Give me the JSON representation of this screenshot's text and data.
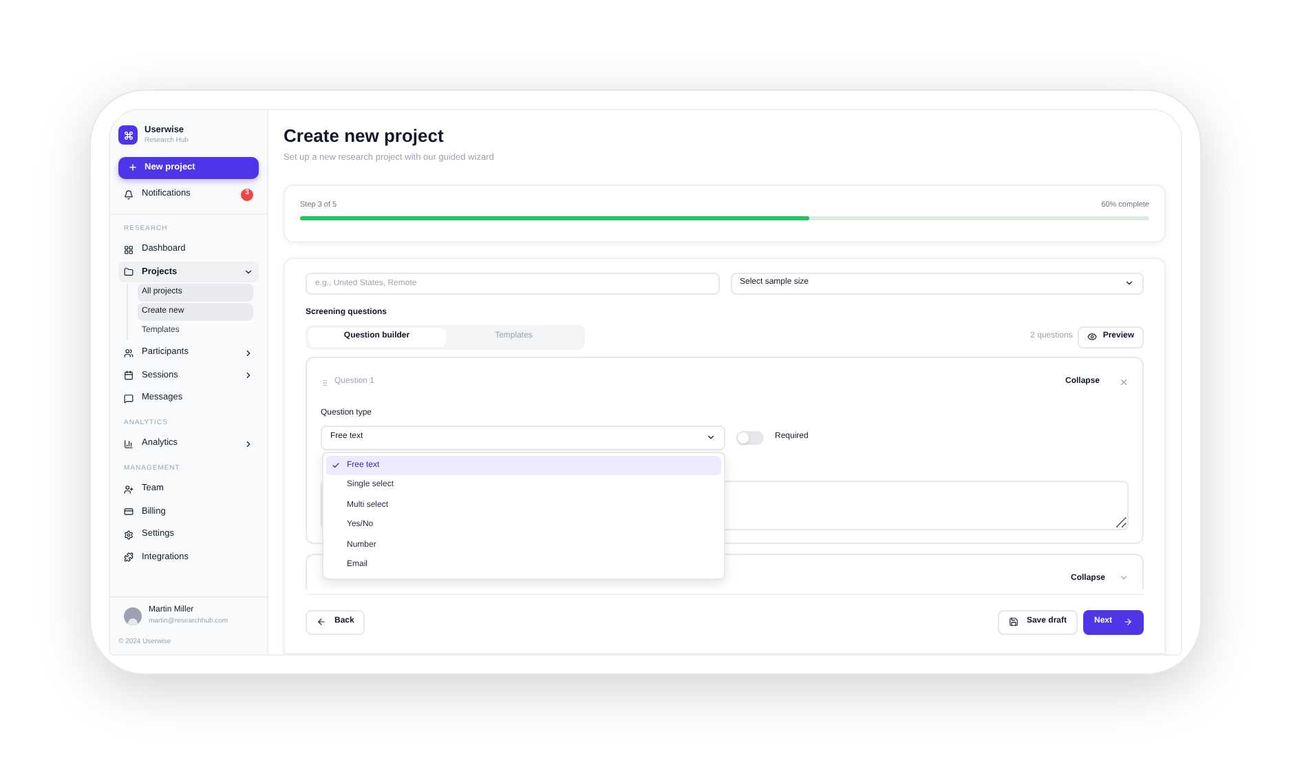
{
  "brand": {
    "name": "Userwise",
    "subtitle": "Research Hub"
  },
  "new_project_button": "New project",
  "notifications": {
    "label": "Notifications",
    "count": "3"
  },
  "sidebar_sections": [
    {
      "title": "RESEARCH",
      "items": [
        {
          "label": "Dashboard",
          "selected": false
        },
        {
          "label": "Projects",
          "selected": true,
          "expanded": true,
          "children": [
            {
              "label": "All projects",
              "selected": true
            },
            {
              "label": "Create new",
              "selected": true
            },
            {
              "label": "Templates",
              "selected": false
            }
          ]
        },
        {
          "label": "Participants",
          "selected": false,
          "expanded": false
        },
        {
          "label": "Sessions",
          "selected": false,
          "expanded": false
        },
        {
          "label": "Messages",
          "selected": false
        }
      ]
    },
    {
      "title": "ANALYTICS",
      "items": [
        {
          "label": "Analytics",
          "selected": false,
          "expanded": false
        }
      ]
    },
    {
      "title": "MANAGEMENT",
      "items": [
        {
          "label": "Team",
          "selected": false
        },
        {
          "label": "Billing",
          "selected": false
        },
        {
          "label": "Settings",
          "selected": false
        },
        {
          "label": "Integrations",
          "selected": false
        }
      ]
    }
  ],
  "user": {
    "name": "Martin Miller",
    "email": "martin@researchhub.com"
  },
  "footer": "© 2024 Userwise",
  "page": {
    "title": "Create new project",
    "subtitle": "Set up a new research project with our guided wizard"
  },
  "progress": {
    "step": "Step 3 of 5",
    "percent": "60% complete",
    "level": 0.6
  },
  "form": {
    "location_field": {
      "placeholder": "e.g., United States, Remote"
    },
    "sample_size": {
      "value": "Select sample size"
    },
    "section_label": "Screening questions",
    "tabs": [
      {
        "label": "Question builder",
        "selected": true
      },
      {
        "label": "Templates",
        "selected": false
      }
    ],
    "question_count": "2 questions",
    "preview_button": "Preview",
    "questions": [
      {
        "title": "Question 1",
        "collapse": "Collapse",
        "type_label": "Question type",
        "type_value": "Free text",
        "required": {
          "label": "Required",
          "on": false
        }
      },
      {
        "collapse": "Collapse"
      }
    ],
    "type_options": [
      {
        "label": "Free text",
        "selected": true
      },
      {
        "label": "Single select",
        "selected": false
      },
      {
        "label": "Multi select",
        "selected": false
      },
      {
        "label": "Yes/No",
        "selected": false
      },
      {
        "label": "Number",
        "selected": false
      },
      {
        "label": "Email",
        "selected": false
      }
    ]
  },
  "footer_buttons": {
    "back": "Back",
    "save": "Save draft",
    "next": "Next"
  }
}
